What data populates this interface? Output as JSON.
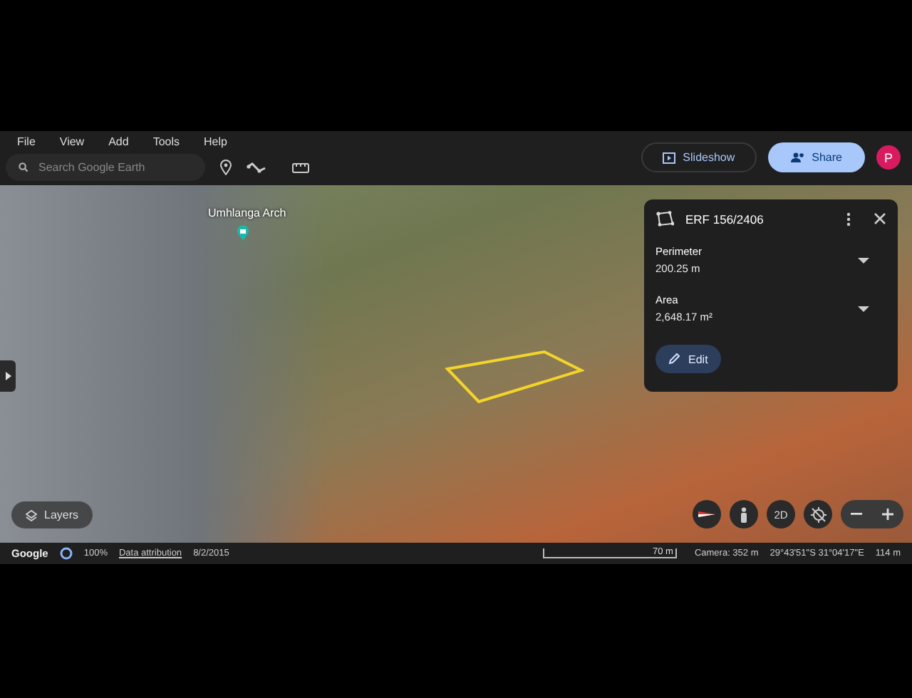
{
  "menu": [
    "File",
    "View",
    "Add",
    "Tools",
    "Help"
  ],
  "search": {
    "placeholder": "Search Google Earth"
  },
  "header_buttons": {
    "slideshow": "Slideshow",
    "share": "Share",
    "avatar": "P"
  },
  "map": {
    "place_label": "Umhlanga Arch",
    "layers_button": "Layers",
    "view_toggle": "2D"
  },
  "panel": {
    "title": "ERF 156/2406",
    "measurements": [
      {
        "label": "Perimeter",
        "value": "200.25 m",
        "expanded": false
      },
      {
        "label": "Area",
        "value": "2,648.17 m²",
        "expanded": false
      }
    ],
    "edit_button": "Edit"
  },
  "status_bar": {
    "logo": "Google",
    "load": "100%",
    "attribution": "Data attribution",
    "date": "8/2/2015",
    "scale": "70 m",
    "camera": "Camera: 352 m",
    "coordinates": "29°43'51\"S 31°04'17\"E",
    "elevation": "114 m"
  }
}
